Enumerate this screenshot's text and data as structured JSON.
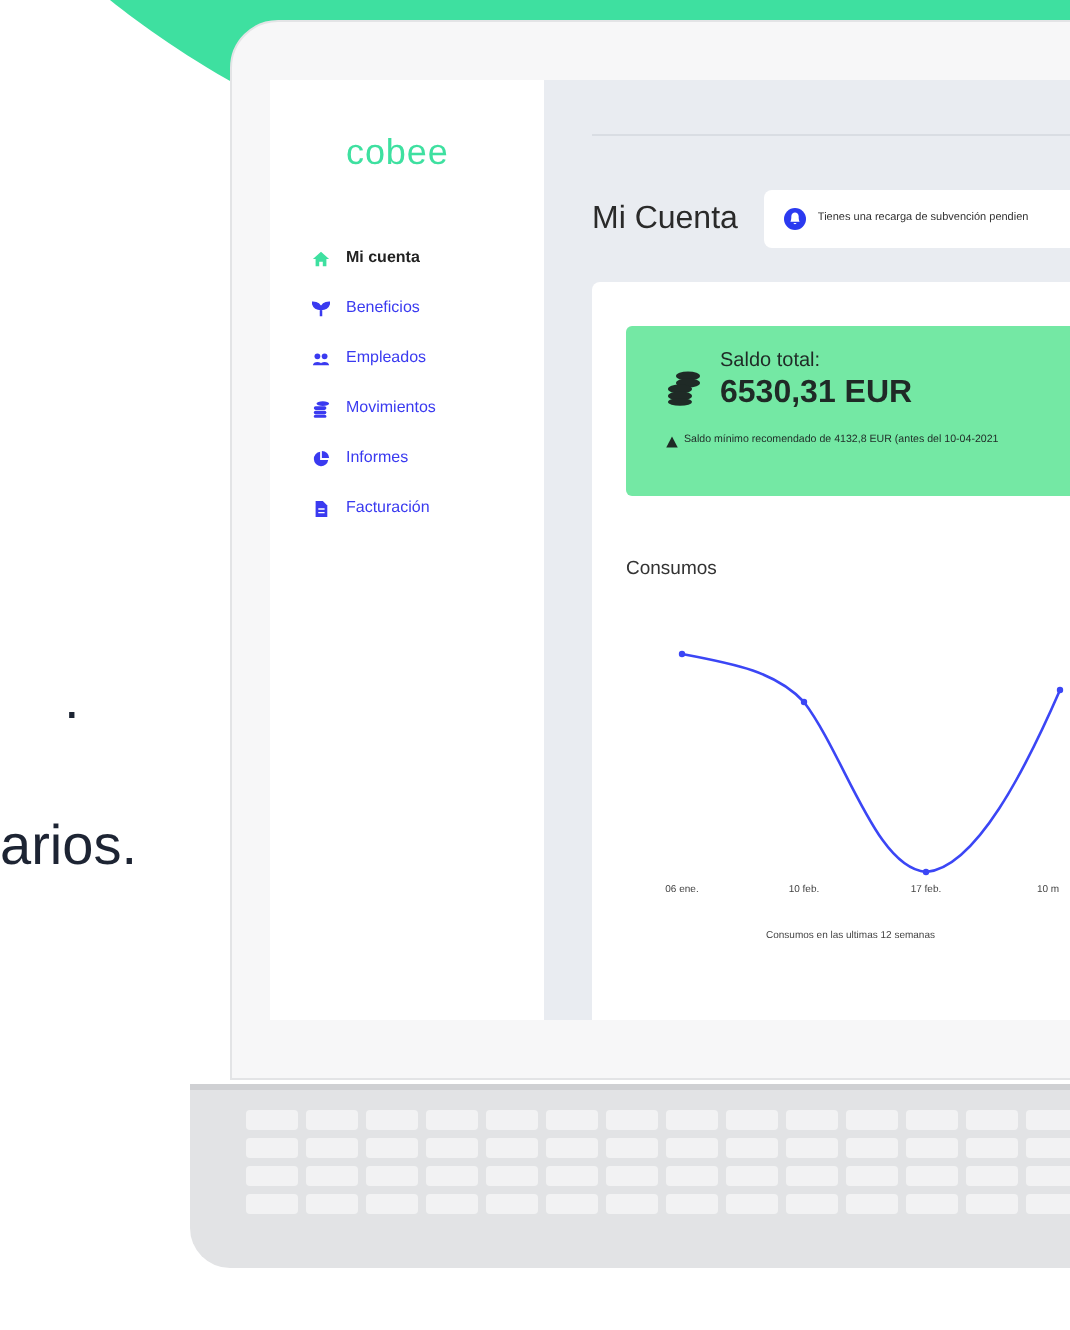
{
  "background_text": [
    {
      "text": "."
    },
    {
      "text": "arios."
    }
  ],
  "app": {
    "logo": "cobee",
    "sidebar": {
      "items": [
        {
          "label": "Mi cuenta",
          "kind": "home",
          "selected": true
        },
        {
          "label": "Beneficios",
          "kind": "plant",
          "selected": false
        },
        {
          "label": "Empleados",
          "kind": "people",
          "selected": false
        },
        {
          "label": "Movimientos",
          "kind": "coins",
          "selected": false
        },
        {
          "label": "Informes",
          "kind": "pie",
          "selected": false
        },
        {
          "label": "Facturación",
          "kind": "file",
          "selected": false
        }
      ]
    },
    "title": "Mi Cuenta",
    "notification": "Tienes una recarga de subvención pendien",
    "balance": {
      "label": "Saldo total:",
      "amount": "6530,31 EUR",
      "warning": "Saldo mínimo recomendado de 4132,8 EUR (antes del 10-04-2021"
    },
    "consumption": {
      "title": "Consumos",
      "x_labels": [
        "06 ene.",
        "10 feb.",
        "17 feb.",
        "10 m"
      ],
      "caption": "Consumos en las ultimas 12 semanas"
    }
  }
}
